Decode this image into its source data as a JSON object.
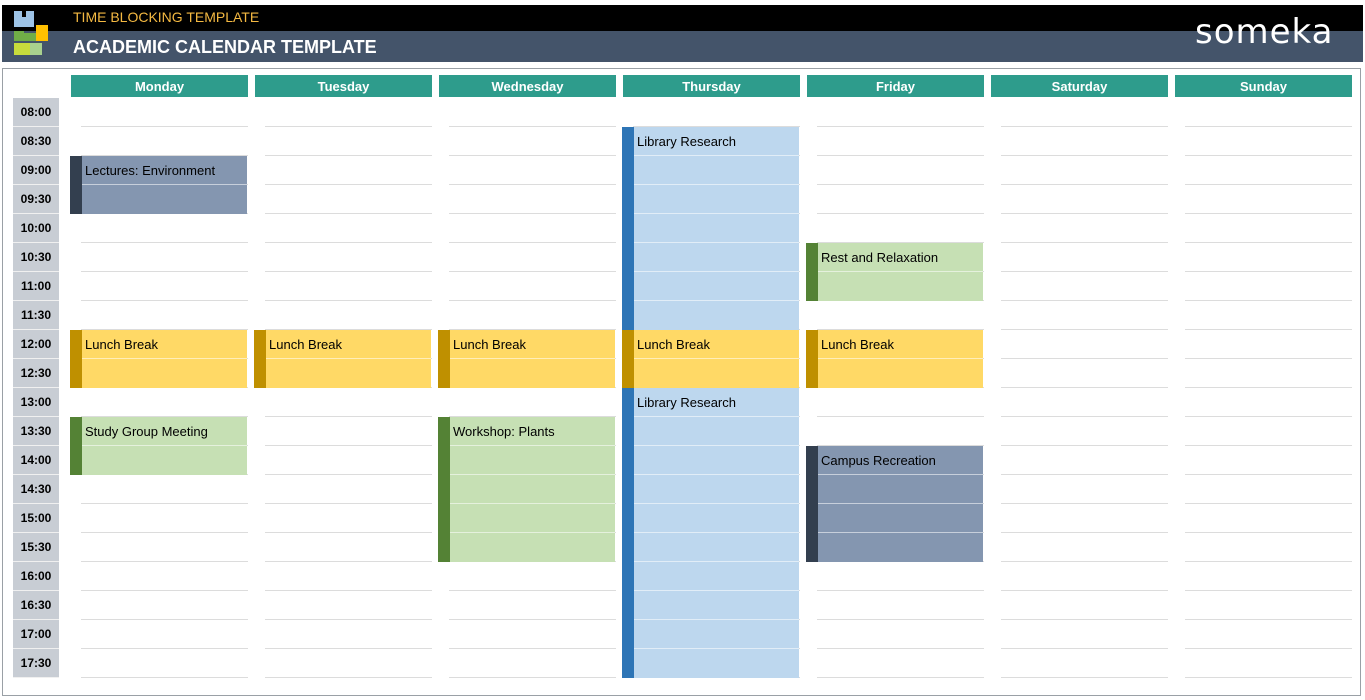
{
  "header": {
    "subtitle": "TIME BLOCKING TEMPLATE",
    "title": "ACADEMIC CALENDAR TEMPLATE",
    "brand": "someka"
  },
  "days": [
    "Monday",
    "Tuesday",
    "Wednesday",
    "Thursday",
    "Friday",
    "Saturday",
    "Sunday"
  ],
  "times": [
    "08:00",
    "08:30",
    "09:00",
    "09:30",
    "10:00",
    "10:30",
    "11:00",
    "11:30",
    "12:00",
    "12:30",
    "13:00",
    "13:30",
    "14:00",
    "14:30",
    "15:00",
    "15:30",
    "16:00",
    "16:30",
    "17:00",
    "17:30"
  ],
  "colors": {
    "slate": {
      "bg": "#8496b0",
      "bar": "#333f4f"
    },
    "yellow": {
      "bg": "#ffd966",
      "bar": "#bf9000"
    },
    "green": {
      "bg": "#c6e0b4",
      "bar": "#548235"
    },
    "blue": {
      "bg": "#bdd7ee",
      "bar": "#2e75b6"
    }
  },
  "events": [
    {
      "day": 0,
      "start": "09:00",
      "end": "10:00",
      "title": "Lectures: Environment",
      "color": "slate"
    },
    {
      "day": 0,
      "start": "12:00",
      "end": "13:00",
      "title": "Lunch Break",
      "color": "yellow"
    },
    {
      "day": 0,
      "start": "13:30",
      "end": "14:30",
      "title": "Study Group Meeting",
      "color": "green"
    },
    {
      "day": 1,
      "start": "12:00",
      "end": "13:00",
      "title": "Lunch Break",
      "color": "yellow"
    },
    {
      "day": 2,
      "start": "12:00",
      "end": "13:00",
      "title": "Lunch Break",
      "color": "yellow"
    },
    {
      "day": 2,
      "start": "13:30",
      "end": "16:00",
      "title": "Workshop: Plants",
      "color": "green"
    },
    {
      "day": 3,
      "start": "08:30",
      "end": "12:00",
      "title": "Library Research",
      "color": "blue"
    },
    {
      "day": 3,
      "start": "12:00",
      "end": "13:00",
      "title": "Lunch Break",
      "color": "yellow"
    },
    {
      "day": 3,
      "start": "13:00",
      "end": "18:00",
      "title": "Library Research",
      "color": "blue"
    },
    {
      "day": 4,
      "start": "10:30",
      "end": "11:30",
      "title": "Rest and Relaxation",
      "color": "green"
    },
    {
      "day": 4,
      "start": "12:00",
      "end": "13:00",
      "title": "Lunch Break",
      "color": "yellow"
    },
    {
      "day": 4,
      "start": "14:00",
      "end": "16:00",
      "title": "Campus Recreation",
      "color": "slate"
    }
  ]
}
